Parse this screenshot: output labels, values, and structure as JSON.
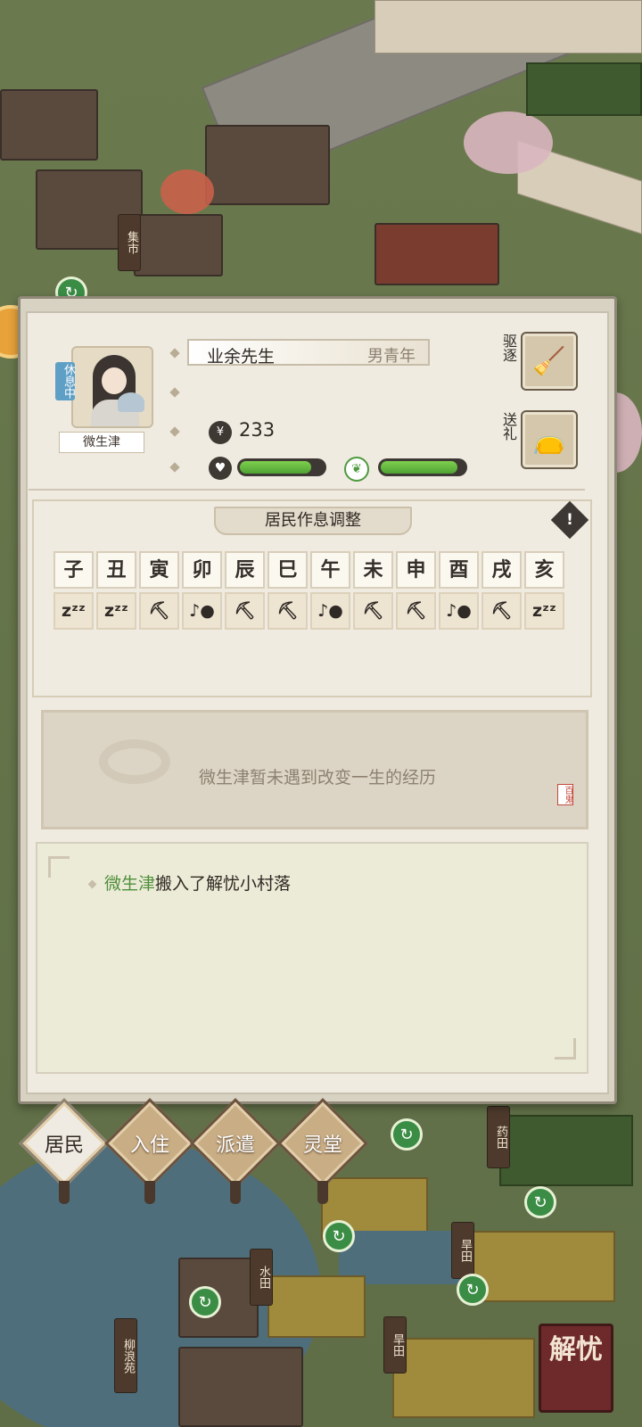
{
  "scene": {
    "signs": [
      "集市",
      "药田",
      "旱田",
      "水田",
      "柳浪苑",
      "旱田"
    ]
  },
  "resident": {
    "status": "休息中",
    "name": "微生津",
    "title": "业余先生",
    "gender_age": "男青年",
    "money": "233",
    "health_level": 0.85,
    "mood_level": 0.92
  },
  "actions": {
    "expel_label": "驱逐",
    "gift_label": "送礼",
    "expel_icon": "broom-icon",
    "gift_icon": "bag-icon"
  },
  "schedule": {
    "title": "居民作息调整",
    "warn_icon": "!",
    "hours": [
      "子",
      "丑",
      "寅",
      "卯",
      "辰",
      "巳",
      "午",
      "未",
      "申",
      "酉",
      "戌",
      "亥"
    ],
    "activities": [
      "sleep",
      "sleep",
      "work",
      "leisure",
      "work",
      "work",
      "leisure",
      "work",
      "work",
      "leisure",
      "work",
      "sleep"
    ],
    "activity_glyphs": {
      "sleep": "zᶻᶻ",
      "work": "⛏",
      "leisure": "♪●"
    }
  },
  "event": {
    "text": "微生津暂未遇到改变一生的经历",
    "seal": "百鬼"
  },
  "log": {
    "name": "微生津",
    "text": "搬入了解忧小村落"
  },
  "nav": {
    "items": [
      "居民",
      "入住",
      "派遣",
      "灵堂"
    ],
    "active": 0
  },
  "corner_button": "解忧"
}
